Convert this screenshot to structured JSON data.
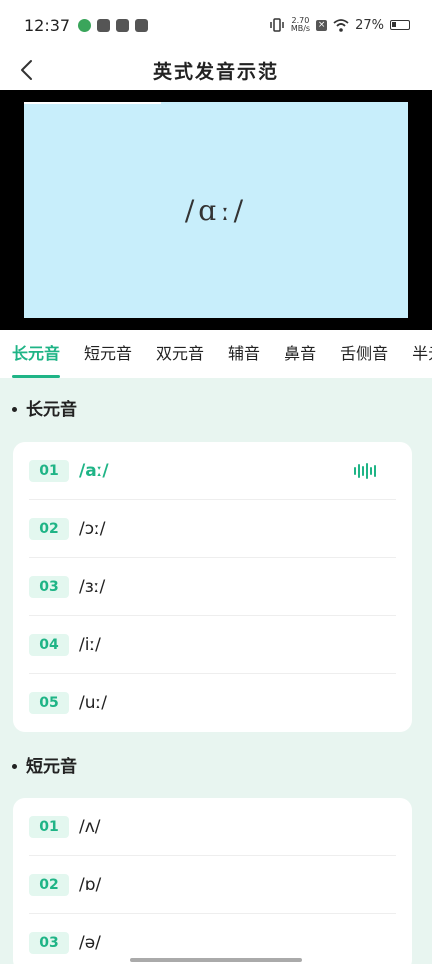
{
  "status": {
    "time": "12:37",
    "speed_top": "2.70",
    "speed_bottom": "MB/s",
    "battery": "27%"
  },
  "nav": {
    "title": "英式发音示范"
  },
  "video": {
    "phoneme": "/ɑː/"
  },
  "tabs": [
    {
      "label": "长元音"
    },
    {
      "label": "短元音"
    },
    {
      "label": "双元音"
    },
    {
      "label": "辅音"
    },
    {
      "label": "鼻音"
    },
    {
      "label": "舌侧音"
    },
    {
      "label": "半元音"
    }
  ],
  "sections": [
    {
      "title": "长元音",
      "items": [
        {
          "num": "01",
          "symbol": "/aː/"
        },
        {
          "num": "02",
          "symbol": "/ɔː/"
        },
        {
          "num": "03",
          "symbol": "/ɜː/"
        },
        {
          "num": "04",
          "symbol": "/iː/"
        },
        {
          "num": "05",
          "symbol": "/uː/"
        }
      ]
    },
    {
      "title": "短元音",
      "items": [
        {
          "num": "01",
          "symbol": "/ʌ/"
        },
        {
          "num": "02",
          "symbol": "/ɒ/"
        },
        {
          "num": "03",
          "symbol": "/ə/"
        }
      ]
    }
  ],
  "colors": {
    "accent": "#1fb486",
    "background": "#e8f5f0",
    "video_bg": "#c8eefb"
  },
  "icons": {
    "back": "chevron-left-icon",
    "playing": "sound-wave-icon"
  }
}
